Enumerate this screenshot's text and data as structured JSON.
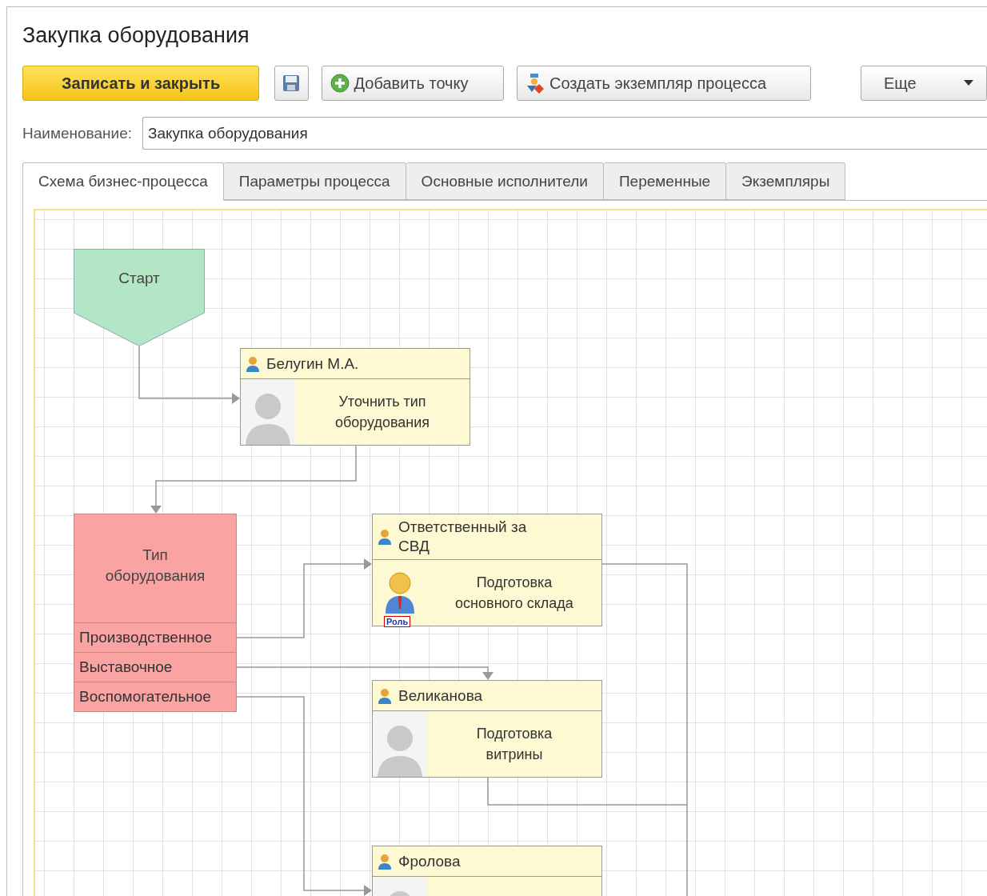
{
  "window": {
    "title": "Закупка оборудования"
  },
  "toolbar": [
    {
      "kind": "primary",
      "label": "Записать и закрыть"
    },
    {
      "kind": "save"
    },
    {
      "kind": "add",
      "label": "Добавить точку"
    },
    {
      "kind": "process",
      "label": "Создать экземпляр процесса"
    },
    {
      "kind": "more",
      "label": "Еще"
    }
  ],
  "name_field": {
    "label": "Наименование:",
    "value": "Закупка оборудования"
  },
  "tabs": [
    {
      "label": "Схема бизнес-процесса",
      "selected": true
    },
    {
      "label": "Параметры процесса",
      "selected": false
    },
    {
      "label": "Основные исполнители",
      "selected": false
    },
    {
      "label": "Переменные",
      "selected": false
    },
    {
      "label": "Экземпляры",
      "selected": false
    }
  ],
  "diagram": {
    "nodes": [
      {
        "kind": "start",
        "label": "Старт"
      },
      {
        "kind": "task",
        "performer": "Белугин М.А.",
        "text": "Уточнить тип оборудования",
        "avatar": {
          "kind": "photo"
        }
      },
      {
        "kind": "condition",
        "label": "Тип оборудования",
        "branches": [
          "Производственное",
          "Выставочное",
          "Воспомогательное"
        ]
      },
      {
        "kind": "task",
        "performer": "Ответственный за СВД",
        "text": "Подготовка основного склада",
        "avatar": {
          "kind": "role",
          "badge": "Роль"
        }
      },
      {
        "kind": "task",
        "performer": "Великанова",
        "text": "Подготовка витрины",
        "avatar": {
          "kind": "photo"
        }
      },
      {
        "kind": "task",
        "performer": "Фролова",
        "avatar": {
          "kind": "photo"
        }
      }
    ]
  }
}
